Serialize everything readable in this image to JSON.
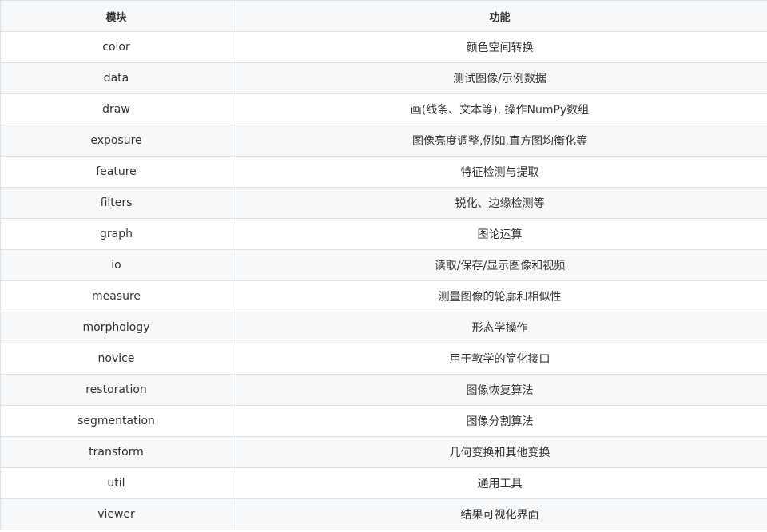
{
  "table": {
    "headers": [
      "模块",
      "功能"
    ],
    "rows": [
      {
        "module": "color",
        "function": "颜色空间转换"
      },
      {
        "module": "data",
        "function": "测试图像/示例数据"
      },
      {
        "module": "draw",
        "function": "画(线条、文本等), 操作NumPy数组"
      },
      {
        "module": "exposure",
        "function": "图像亮度调整,例如,直方图均衡化等"
      },
      {
        "module": "feature",
        "function": "特征检测与提取"
      },
      {
        "module": "filters",
        "function": "锐化、边缘检测等"
      },
      {
        "module": "graph",
        "function": "图论运算"
      },
      {
        "module": "io",
        "function": "读取/保存/显示图像和视频"
      },
      {
        "module": "measure",
        "function": "测量图像的轮廓和相似性"
      },
      {
        "module": "morphology",
        "function": "形态学操作"
      },
      {
        "module": "novice",
        "function": "用于教学的简化接口"
      },
      {
        "module": "restoration",
        "function": "图像恢复算法"
      },
      {
        "module": "segmentation",
        "function": "图像分割算法"
      },
      {
        "module": "transform",
        "function": "几何变换和其他变换"
      },
      {
        "module": "util",
        "function": "通用工具"
      },
      {
        "module": "viewer",
        "function": "结果可视化界面"
      }
    ]
  }
}
